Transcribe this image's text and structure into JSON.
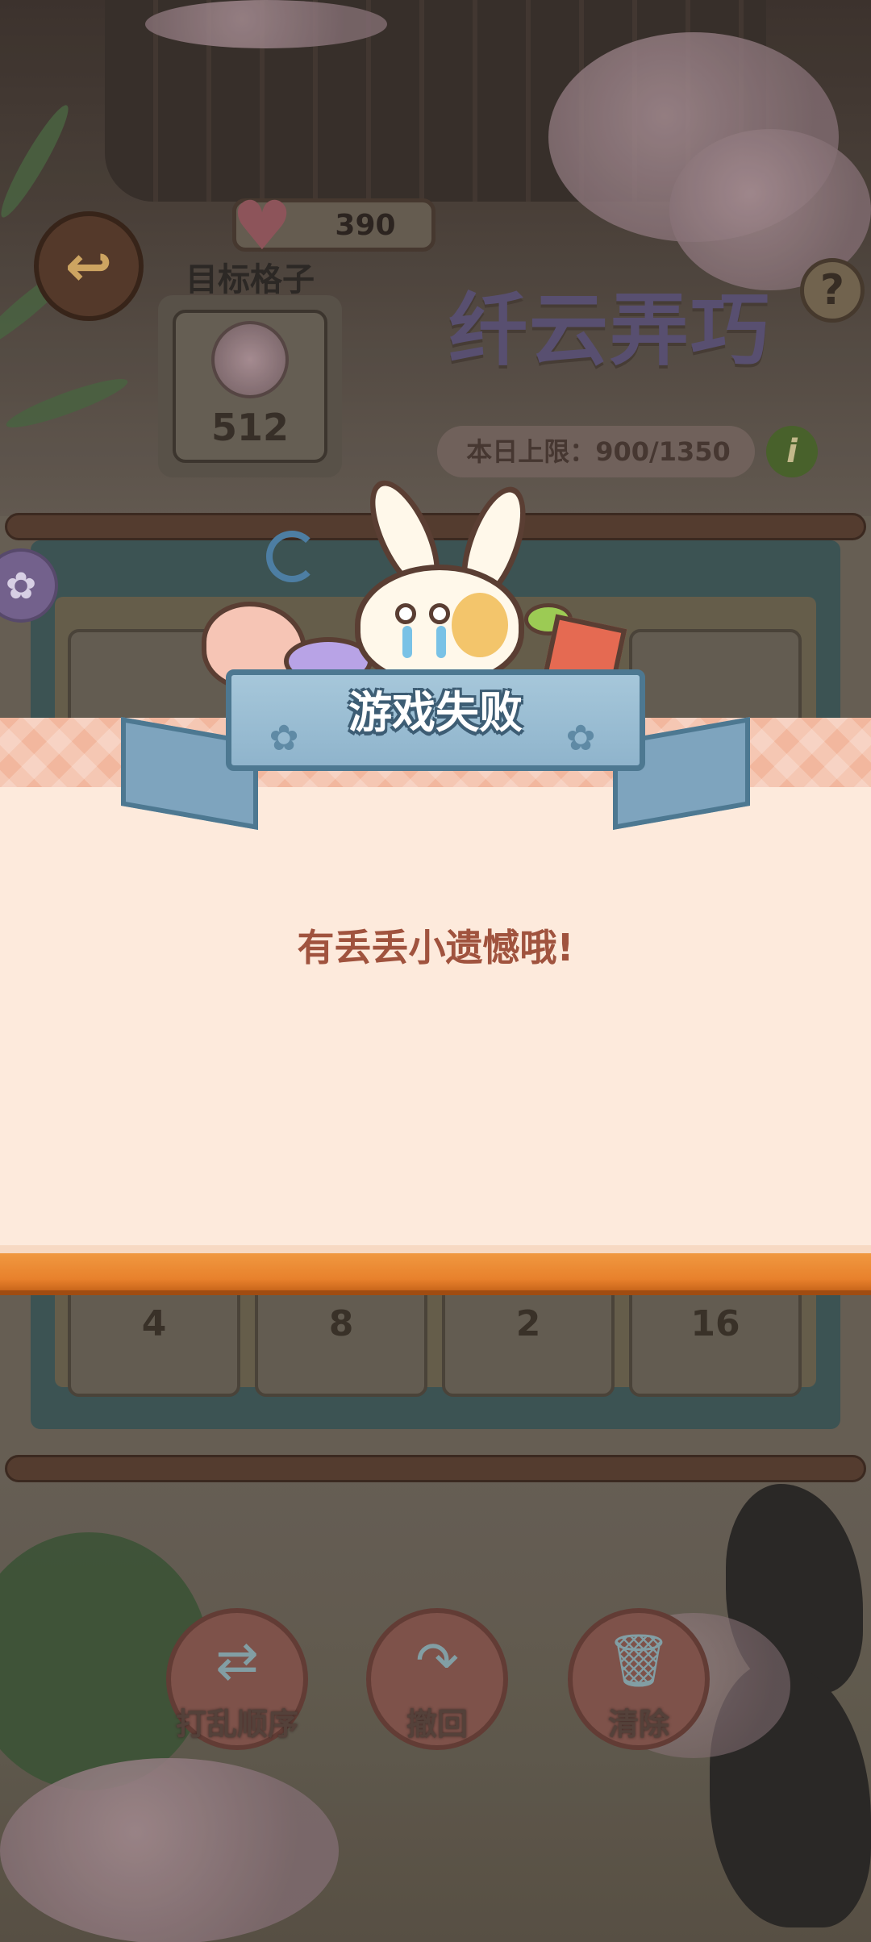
{
  "hud": {
    "back_icon": "back-arrow-icon",
    "lives_icon": "heart-icon",
    "lives_value": "390",
    "target_label": "目标格子",
    "target_value": "512",
    "game_title": "纤云弄巧",
    "help_icon": "?",
    "daily_limit": "本日上限：900/1350",
    "info_icon": "i"
  },
  "board": {
    "bottom_row_values": [
      "4",
      "8",
      "2",
      "16"
    ]
  },
  "actions": {
    "shuffle_label": "打乱顺序",
    "undo_label": "撤回",
    "clear_label": "清除"
  },
  "popup": {
    "title": "游戏失败",
    "message": "有丢丢小遗憾哦!"
  },
  "colors": {
    "ribbon": "#8fb4cc",
    "ribbon_border": "#4d7891",
    "dialog_body": "#fdeadc",
    "dialog_stripe": "#f2b79e",
    "dialog_bottom": "#e8812c",
    "message_text": "#a0533e"
  }
}
